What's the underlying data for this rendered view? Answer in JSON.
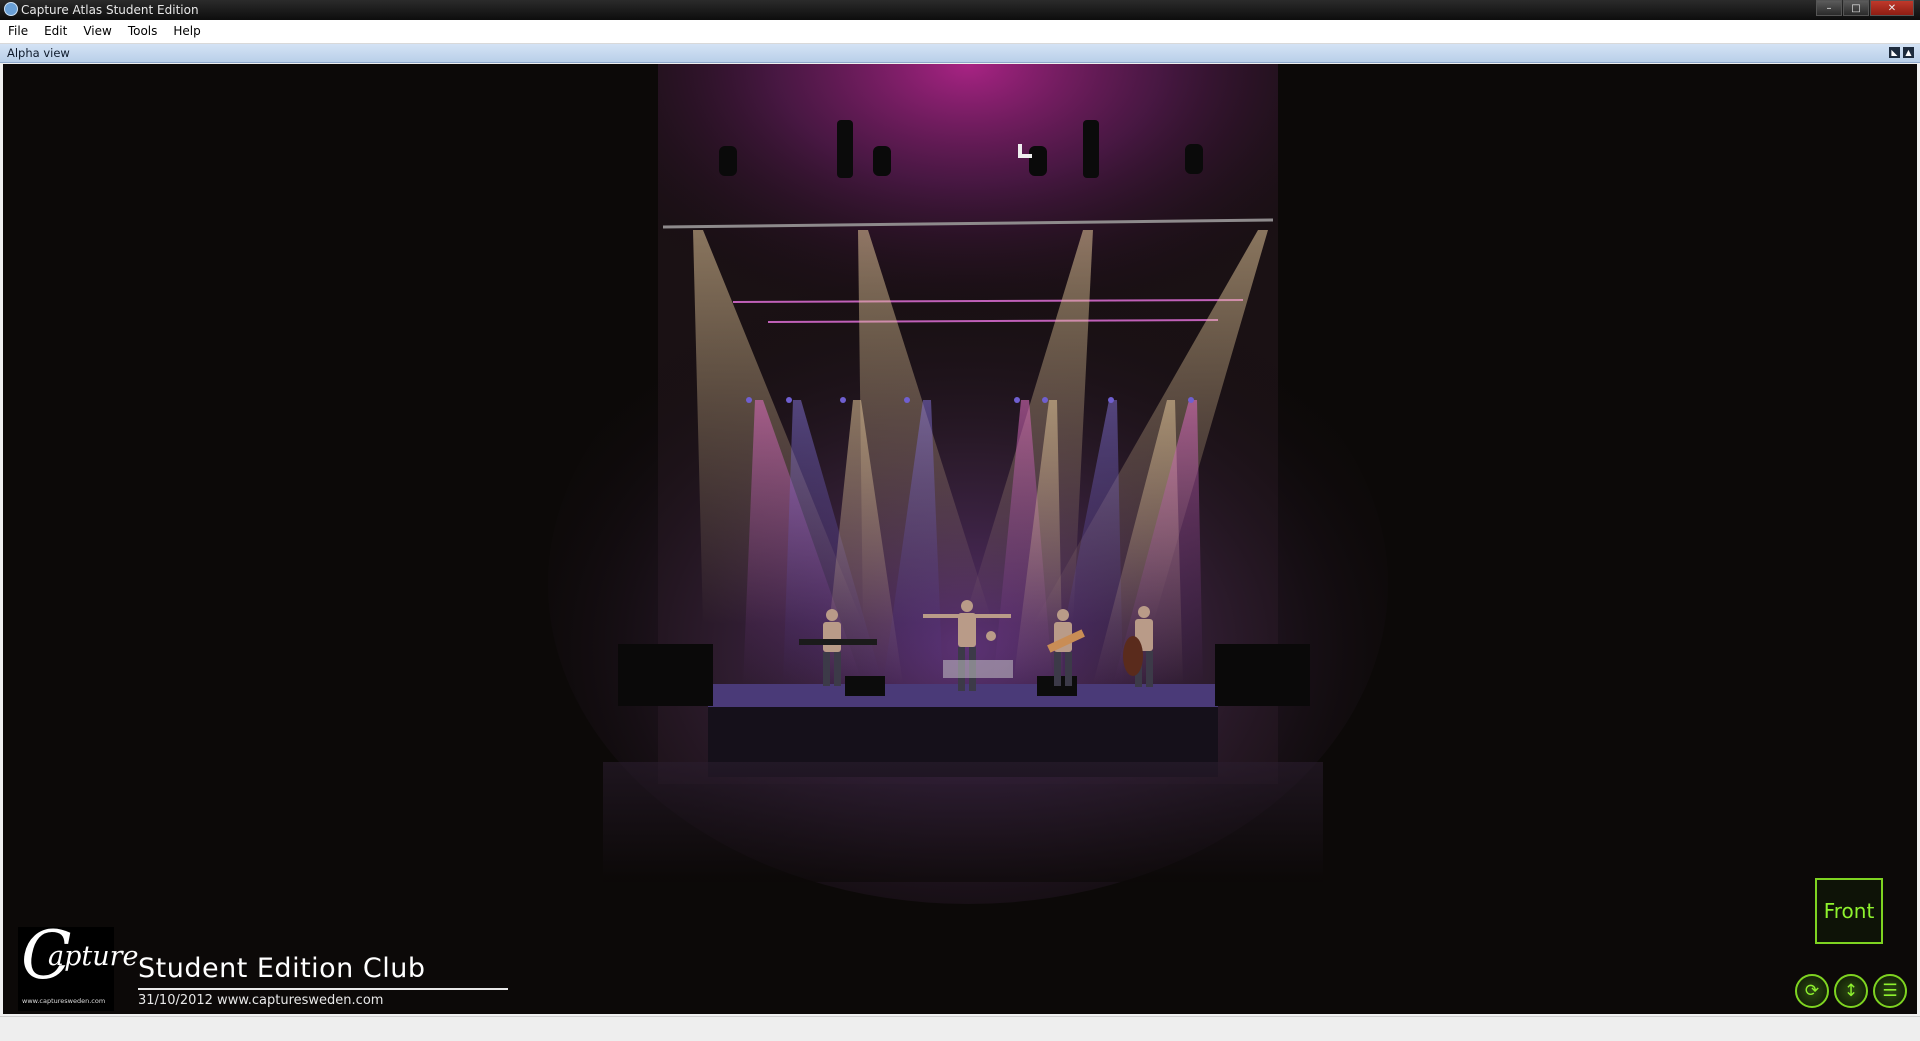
{
  "window": {
    "title": "Capture Atlas Student Edition",
    "buttons": {
      "minimize": "–",
      "maximize": "□",
      "close": "✕"
    }
  },
  "menu": [
    "File",
    "Edit",
    "View",
    "Tools",
    "Help"
  ],
  "panel": {
    "title": "Alpha view"
  },
  "viewport": {
    "project_title": "Student Edition Club",
    "project_subtitle": "31/10/2012 www.capturesweden.com",
    "logo": {
      "letter": "C",
      "word": "apture",
      "url": "www.capturesweden.com"
    },
    "view_button": "Front",
    "nav_icons": [
      "rotate-icon",
      "move-icon",
      "menu-icon"
    ]
  },
  "colors": {
    "accent_green": "#7ed321",
    "stage_purple": "#7a3ea8",
    "spot_pink": "#c2378f"
  }
}
